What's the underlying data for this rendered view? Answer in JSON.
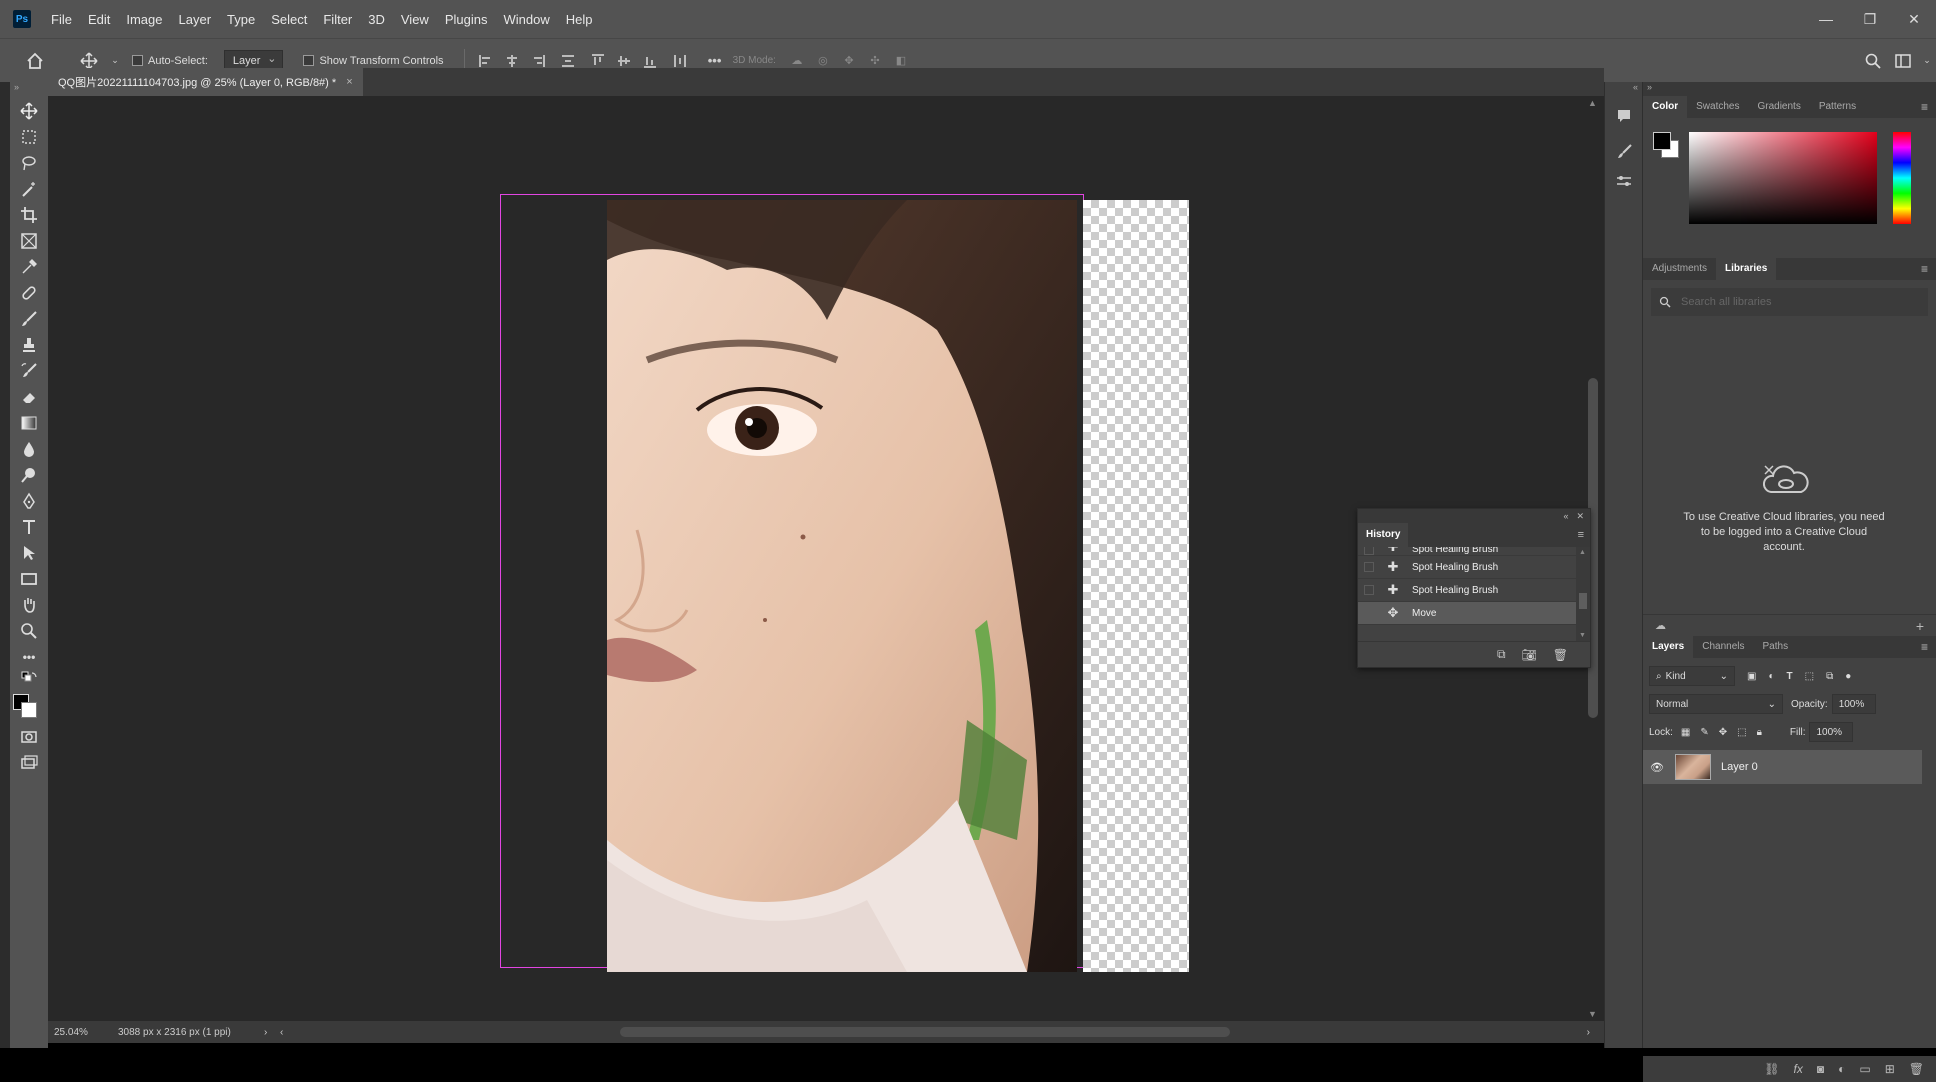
{
  "menubar": {
    "logo": "Ps",
    "items": [
      "File",
      "Edit",
      "Image",
      "Layer",
      "Type",
      "Select",
      "Filter",
      "3D",
      "View",
      "Plugins",
      "Window",
      "Help"
    ],
    "window_controls": [
      "—",
      "❐",
      "✕"
    ]
  },
  "options": {
    "auto_select_label": "Auto-Select:",
    "auto_select_value": "Layer",
    "show_transform_label": "Show Transform Controls",
    "more": "•••",
    "mode_label": "3D Mode:"
  },
  "document": {
    "tab_title": "QQ图片20221111104703.jpg @ 25% (Layer 0, RGB/8#) *",
    "close": "×",
    "zoom": "25.04%",
    "doc_info": "3088 px x 2316 px (1 ppi)",
    "status_arrow": "›",
    "scroll_left": "‹",
    "scroll_right": "›"
  },
  "color_panel": {
    "tabs": [
      "Color",
      "Swatches",
      "Gradients",
      "Patterns"
    ],
    "active_tab": "Color",
    "foreground": "#000000",
    "background": "#ffffff",
    "hue_color": "#e3001b"
  },
  "libraries_panel": {
    "tabs": [
      "Adjustments",
      "Libraries"
    ],
    "active_tab": "Libraries",
    "search_placeholder": "Search all libraries",
    "message": "To use Creative Cloud libraries, you need to be logged into a Creative Cloud account."
  },
  "layers_panel": {
    "tabs": [
      "Layers",
      "Channels",
      "Paths"
    ],
    "active_tab": "Layers",
    "kind_label": "Kind",
    "blend_mode": "Normal",
    "opacity_label": "Opacity:",
    "opacity_value": "100%",
    "lock_label": "Lock:",
    "fill_label": "Fill:",
    "fill_value": "100%",
    "layers": [
      {
        "name": "Layer 0",
        "visible": true
      }
    ]
  },
  "history_panel": {
    "title": "History",
    "items": [
      {
        "label": "Spot Healing Brush",
        "icon": "healing-brush-icon"
      },
      {
        "label": "Spot Healing Brush",
        "icon": "healing-brush-icon"
      },
      {
        "label": "Spot Healing Brush",
        "icon": "healing-brush-icon"
      },
      {
        "label": "Move",
        "icon": "move-icon",
        "selected": true
      }
    ]
  }
}
